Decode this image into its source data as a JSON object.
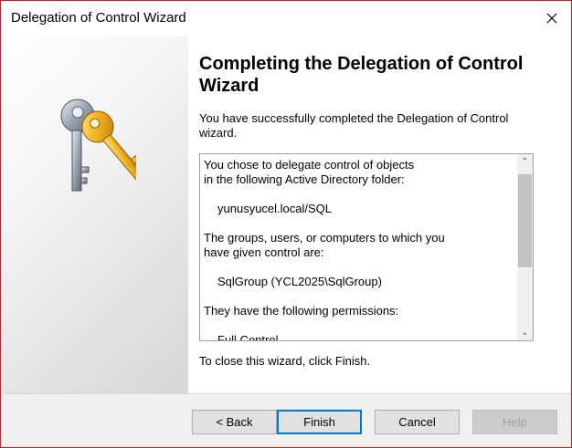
{
  "window": {
    "title": "Delegation of Control Wizard",
    "close_icon": "close-icon"
  },
  "wizard": {
    "heading": "Completing the Delegation of Control Wizard",
    "intro": "You have successfully completed the Delegation of Control wizard.",
    "summary": {
      "line1": "You chose to delegate control of objects",
      "line2": "in the following Active Directory folder:",
      "folder": "yunusyucel.local/SQL",
      "line3": "The groups, users, or computers to which you",
      "line4": "have given control are:",
      "group": "SqlGroup (YCL2025\\SqlGroup)",
      "line5": "They have the following permissions:",
      "permission_partial": "Full Control"
    },
    "closing": "To close this wizard, click Finish."
  },
  "buttons": {
    "back": "< Back",
    "finish": "Finish",
    "cancel": "Cancel",
    "help": "Help"
  },
  "icons": {
    "wizard": "keys-icon",
    "scroll_up": "chevron-up-icon",
    "scroll_down": "chevron-down-icon"
  },
  "colors": {
    "window_border": "#e81123",
    "default_button_border": "#0078d7",
    "footer_bg": "#f0f0f0"
  }
}
